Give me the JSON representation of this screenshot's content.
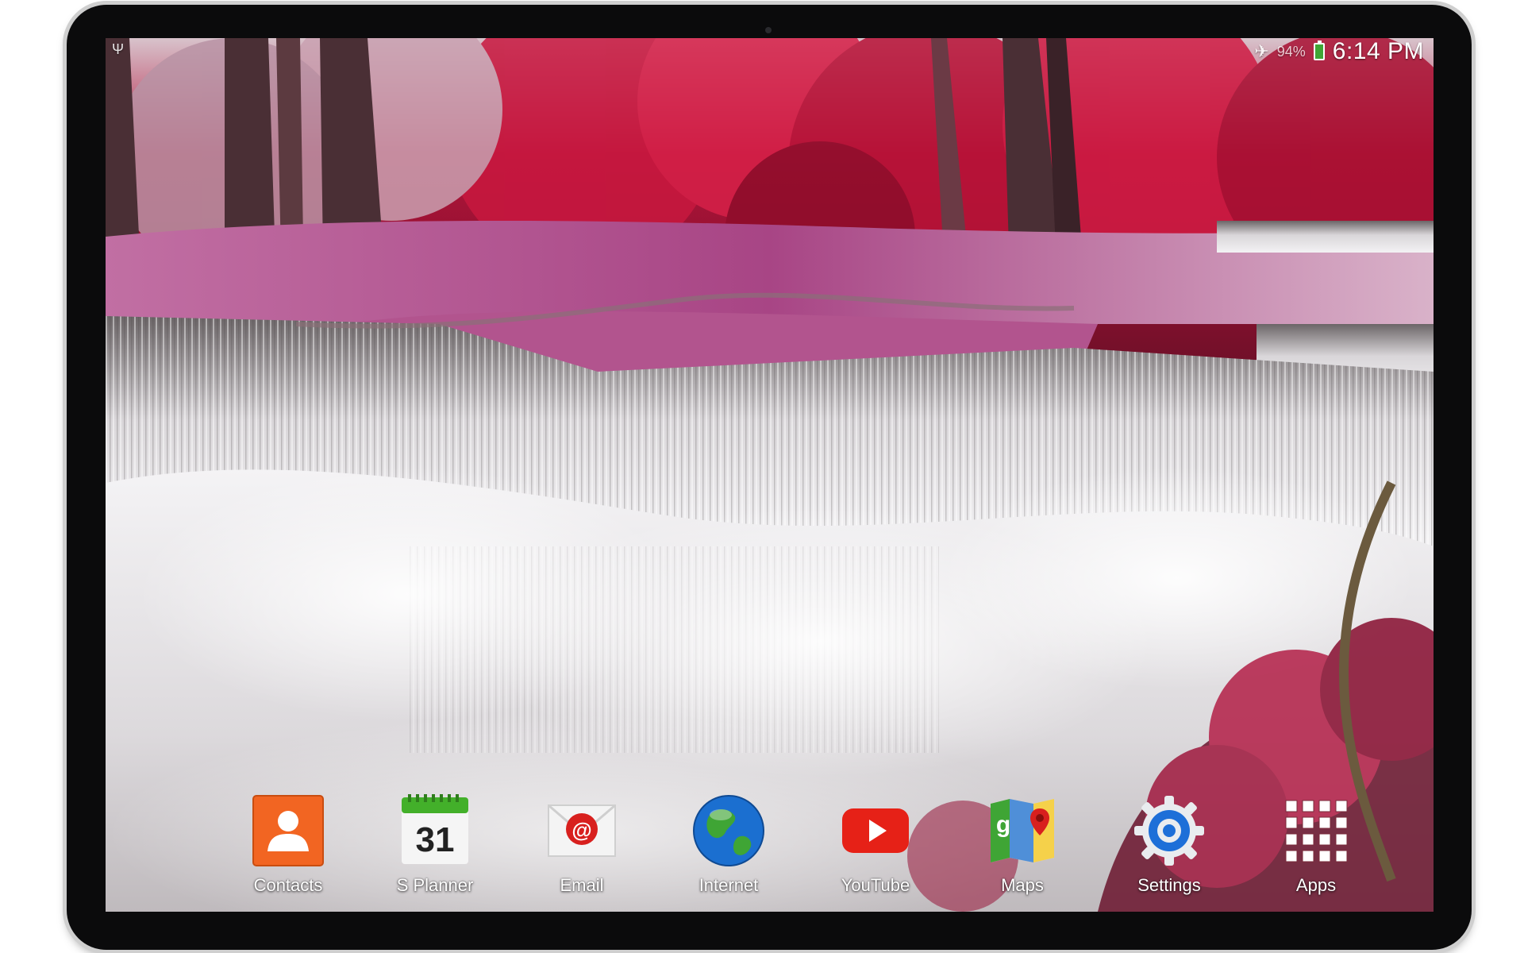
{
  "status_bar": {
    "battery_percent": "94%",
    "time": "6:14 PM"
  },
  "dock": {
    "apps": [
      {
        "label": "Contacts",
        "icon": "contacts-icon"
      },
      {
        "label": "S Planner",
        "icon": "calendar-icon",
        "icon_text": "31"
      },
      {
        "label": "Email",
        "icon": "email-icon"
      },
      {
        "label": "Internet",
        "icon": "globe-icon"
      },
      {
        "label": "YouTube",
        "icon": "youtube-icon"
      },
      {
        "label": "Maps",
        "icon": "maps-icon"
      },
      {
        "label": "Settings",
        "icon": "settings-icon"
      },
      {
        "label": "Apps",
        "icon": "apps-grid-icon"
      }
    ]
  },
  "colors": {
    "contacts": "#f26522",
    "calendar_header": "#43b02a",
    "email_badge": "#d8201e",
    "youtube": "#e62117",
    "settings_ring": "#1d6fd8",
    "forest_red": "#b3143a",
    "pool_magenta": "#b34a8a",
    "water_white": "#eeeef0"
  }
}
